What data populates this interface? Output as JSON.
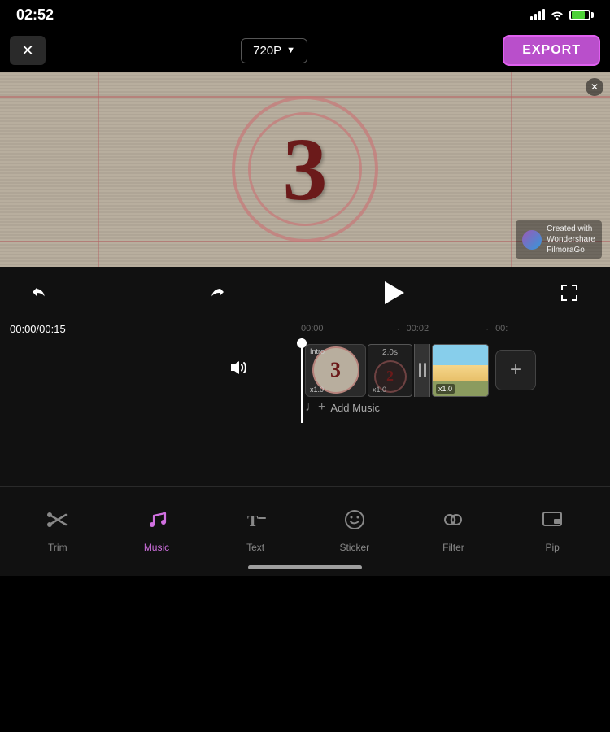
{
  "statusBar": {
    "time": "02:52",
    "icons": {
      "signal": "signal",
      "wifi": "wifi",
      "battery": "battery"
    }
  },
  "toolbar": {
    "closeLabel": "✕",
    "resolution": "720P",
    "resolutionArrow": "▼",
    "exportLabel": "EXPORT"
  },
  "videoPreview": {
    "countdownNumber": "3",
    "watermarkText": "Created with",
    "watermarkBrand": "Wondershare\nFilmoraGo",
    "closeWatermark": "✕"
  },
  "controls": {
    "undoLabel": "undo",
    "redoLabel": "redo",
    "playLabel": "play",
    "fullscreenLabel": "fullscreen",
    "currentTime": "00:00",
    "totalTime": "00:15",
    "separator": "/",
    "timeMarks": [
      "00:00",
      "00:02"
    ],
    "playheadTime": "00:00"
  },
  "timeline": {
    "volumeIcon": "🔊",
    "clips": [
      {
        "type": "intro",
        "label": "Intro",
        "number": "3",
        "speed": "x1.0"
      },
      {
        "type": "transition",
        "label": "2.0s",
        "number": "2",
        "speed": "x1.0"
      },
      {
        "type": "beach",
        "speed": "x1.0"
      }
    ],
    "addMusicLabel": "Add Music",
    "addClipLabel": "+"
  },
  "bottomToolbar": {
    "items": [
      {
        "id": "trim",
        "label": "Trim",
        "icon": "trim",
        "active": false
      },
      {
        "id": "music",
        "label": "Music",
        "icon": "music",
        "active": true
      },
      {
        "id": "text",
        "label": "Text",
        "icon": "text",
        "active": false
      },
      {
        "id": "sticker",
        "label": "Sticker",
        "icon": "sticker",
        "active": false
      },
      {
        "id": "filter",
        "label": "Filter",
        "icon": "filter",
        "active": false
      },
      {
        "id": "pip",
        "label": "Pip",
        "icon": "pip",
        "active": false
      }
    ]
  }
}
